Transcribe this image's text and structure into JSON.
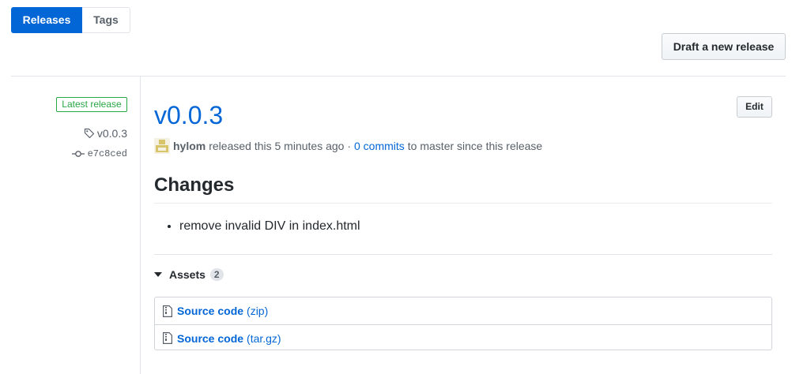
{
  "subnav": {
    "tabs": [
      {
        "label": "Releases",
        "selected": true
      },
      {
        "label": "Tags",
        "selected": false
      }
    ]
  },
  "actions": {
    "draft_label": "Draft a new release",
    "edit_label": "Edit"
  },
  "sidebar": {
    "latest_label": "Latest release",
    "tag": "v0.0.3",
    "commit": "e7c8ced",
    "tag_icon": "tag-icon",
    "commit_icon": "git-commit-icon"
  },
  "release": {
    "title": "v0.0.3",
    "author": "hylom",
    "released_text": "released this 5 minutes ago ·",
    "commits_link": "0 commits",
    "commits_suffix": "to master since this release",
    "changes_heading": "Changes",
    "changes": [
      "remove invalid DIV in index.html"
    ]
  },
  "assets": {
    "label": "Assets",
    "count": "2",
    "items": [
      {
        "name": "Source code",
        "ext": "(zip)"
      },
      {
        "name": "Source code",
        "ext": "(tar.gz)"
      }
    ]
  },
  "colors": {
    "accent": "#0366d6",
    "success": "#28a745",
    "text": "#24292e",
    "muted": "#586069",
    "border": "#e1e4e8"
  }
}
